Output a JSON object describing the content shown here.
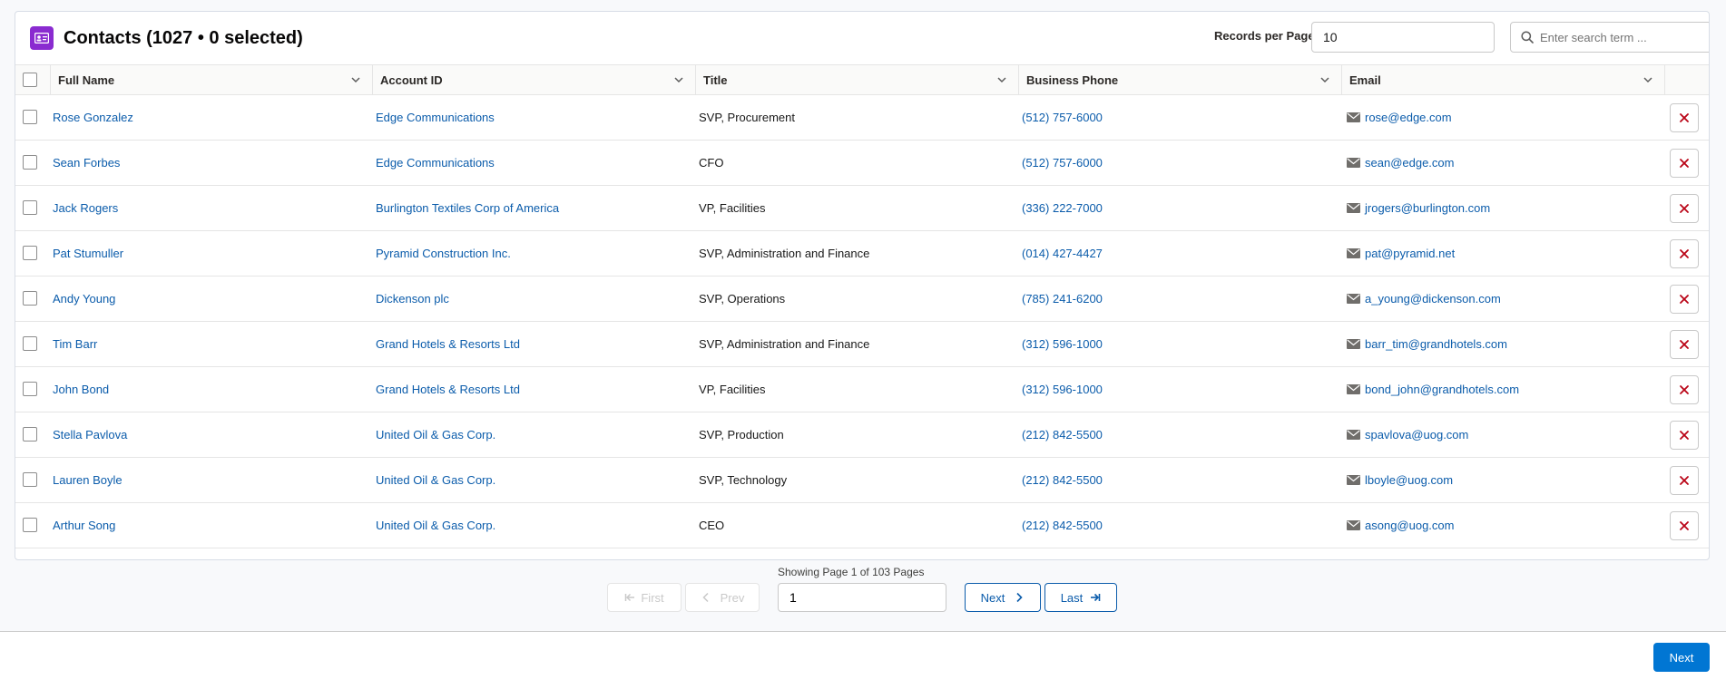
{
  "header": {
    "title": "Contacts (1027 • 0 selected)",
    "app_icon": "contact-card-icon",
    "records_per_page_label": "Records per Page",
    "records_per_page_value": "10",
    "search_placeholder": "Enter search term ..."
  },
  "columns": [
    {
      "label": "Full Name"
    },
    {
      "label": "Account ID"
    },
    {
      "label": "Title"
    },
    {
      "label": "Business Phone"
    },
    {
      "label": "Email"
    }
  ],
  "rows": [
    {
      "name": "Rose Gonzalez",
      "account": "Edge Communications",
      "title": "SVP, Procurement",
      "phone": "(512) 757-6000",
      "email": "rose@edge.com"
    },
    {
      "name": "Sean Forbes",
      "account": "Edge Communications",
      "title": "CFO",
      "phone": "(512) 757-6000",
      "email": "sean@edge.com"
    },
    {
      "name": "Jack Rogers",
      "account": "Burlington Textiles Corp of America",
      "title": "VP, Facilities",
      "phone": "(336) 222-7000",
      "email": "jrogers@burlington.com"
    },
    {
      "name": "Pat Stumuller",
      "account": "Pyramid Construction Inc.",
      "title": "SVP, Administration and Finance",
      "phone": "(014) 427-4427",
      "email": "pat@pyramid.net"
    },
    {
      "name": "Andy Young",
      "account": "Dickenson plc",
      "title": "SVP, Operations",
      "phone": "(785) 241-6200",
      "email": "a_young@dickenson.com"
    },
    {
      "name": "Tim Barr",
      "account": "Grand Hotels & Resorts Ltd",
      "title": "SVP, Administration and Finance",
      "phone": "(312) 596-1000",
      "email": "barr_tim@grandhotels.com"
    },
    {
      "name": "John Bond",
      "account": "Grand Hotels & Resorts Ltd",
      "title": "VP, Facilities",
      "phone": "(312) 596-1000",
      "email": "bond_john@grandhotels.com"
    },
    {
      "name": "Stella Pavlova",
      "account": "United Oil & Gas Corp.",
      "title": "SVP, Production",
      "phone": "(212) 842-5500",
      "email": "spavlova@uog.com"
    },
    {
      "name": "Lauren Boyle",
      "account": "United Oil & Gas Corp.",
      "title": "SVP, Technology",
      "phone": "(212) 842-5500",
      "email": "lboyle@uog.com"
    },
    {
      "name": "Arthur Song",
      "account": "United Oil & Gas Corp.",
      "title": "CEO",
      "phone": "(212) 842-5500",
      "email": "asong@uog.com"
    }
  ],
  "pagination": {
    "status_text": "Showing Page 1 of 103 Pages",
    "first_label": "First",
    "prev_label": "Prev",
    "page_value": "1",
    "next_label": "Next",
    "last_label": "Last"
  },
  "footer": {
    "next_label": "Next"
  },
  "colors": {
    "link": "#0b5cab",
    "brand_icon": "#8a2bd0",
    "primary_button": "#0176d3",
    "delete_icon": "#ba0517"
  }
}
